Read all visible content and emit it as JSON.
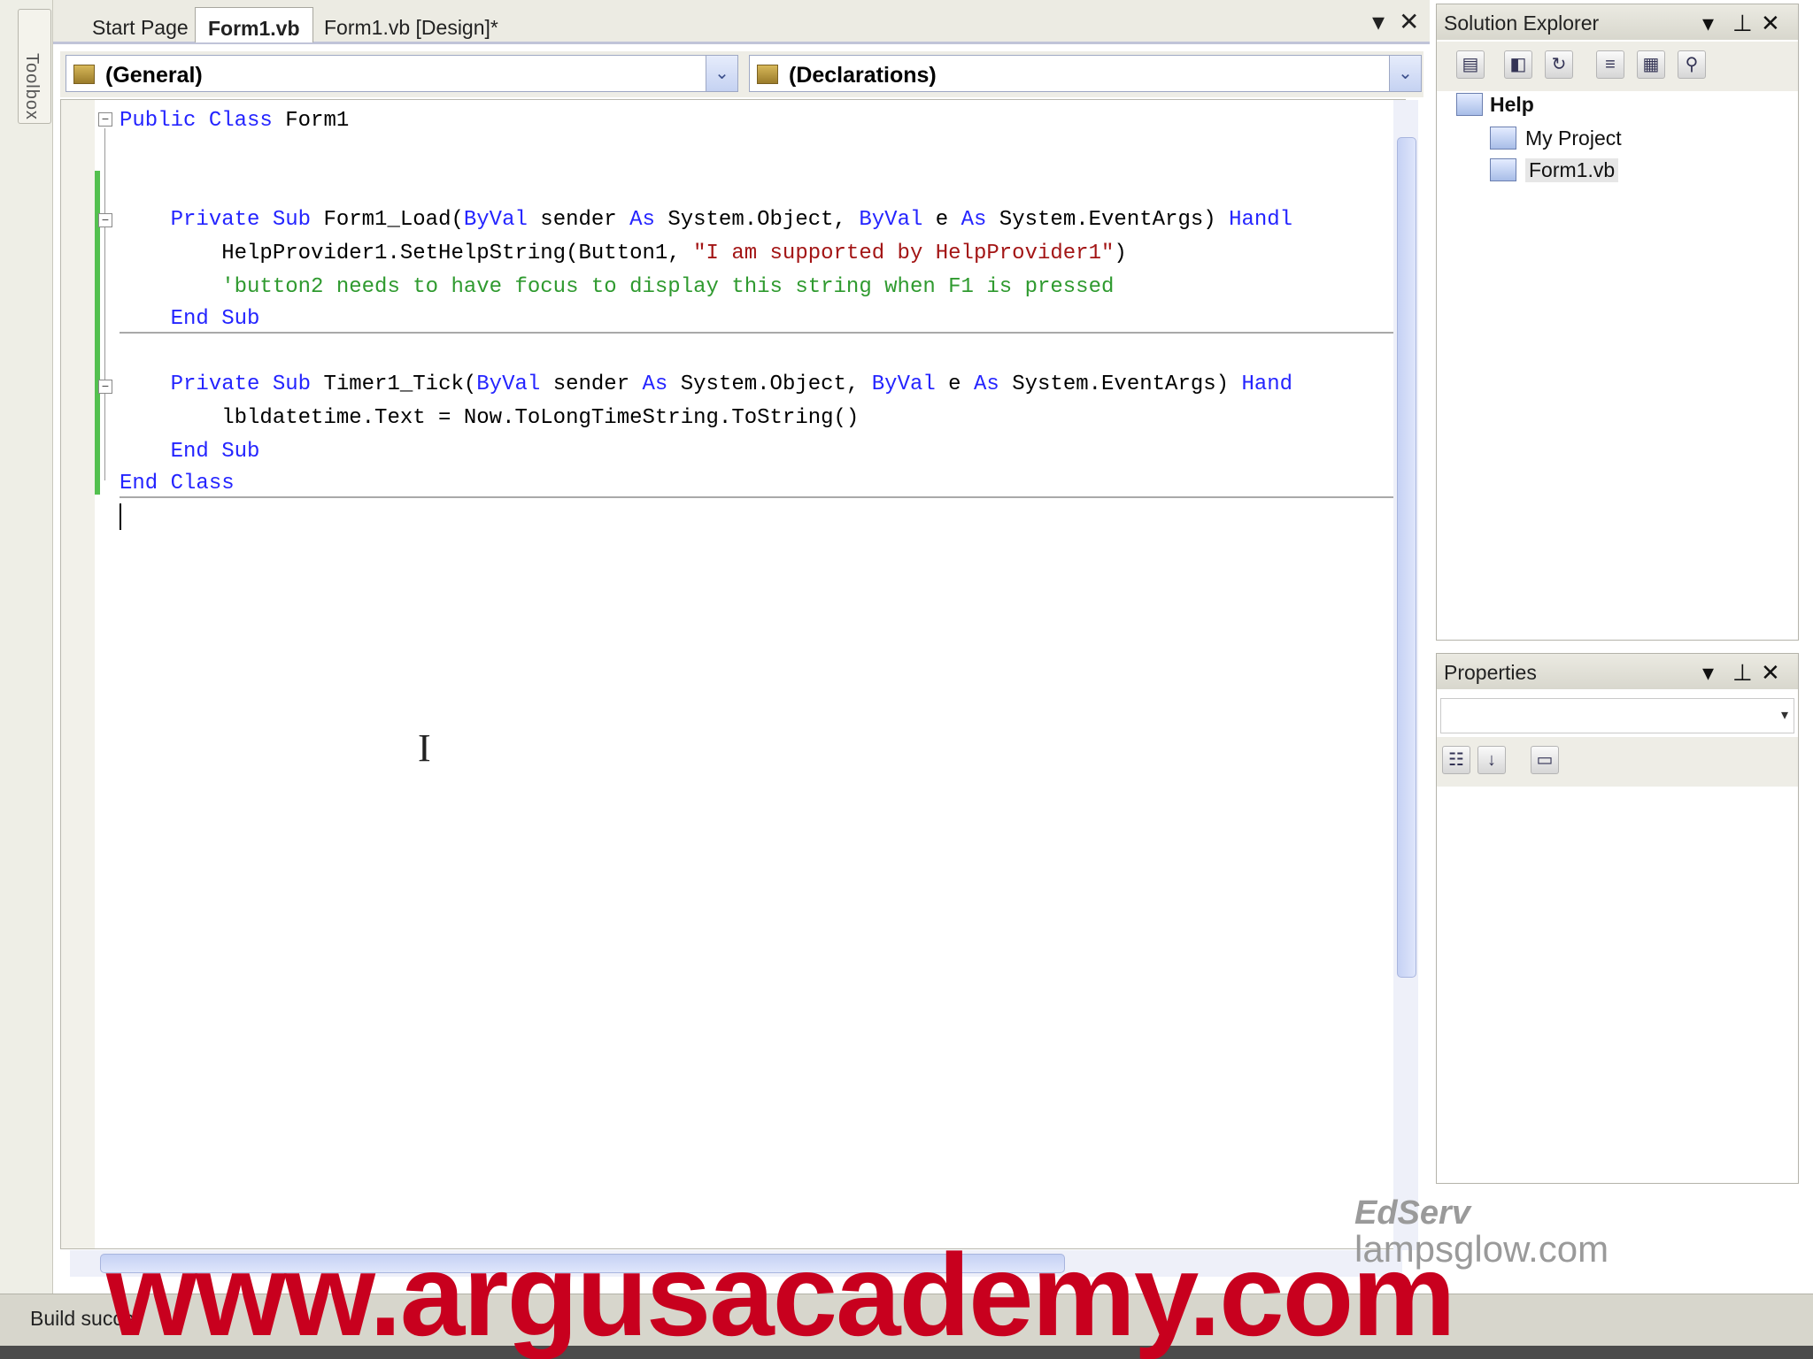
{
  "toolbox": {
    "label": "Toolbox"
  },
  "tabs": [
    {
      "label": "Start Page"
    },
    {
      "label": "Form1.vb"
    },
    {
      "label": "Form1.vb [Design]*"
    }
  ],
  "tab_controls": {
    "menu": "▾",
    "close": "✕"
  },
  "nav": {
    "left_combo": "(General)",
    "right_combo": "(Declarations)",
    "drop_glyph": "⌄"
  },
  "code_lines": [
    {
      "kw1": "Public Class",
      "text": " Form1"
    },
    {
      "indent": "    ",
      "kw1": "Private Sub",
      "text1": " Form1_Load(",
      "kw2": "ByVal",
      "text2": " sender ",
      "kw3": "As",
      "text3": " System.Object, ",
      "kw4": "ByVal",
      "text4": " e ",
      "kw5": "As",
      "text5": " System.EventArgs) ",
      "kw6": "Handl"
    },
    {
      "indent": "        ",
      "text1": "HelpProvider1.SetHelpString(Button1, ",
      "str": "\"I am supported by HelpProvider1\"",
      "text2": ")"
    },
    {
      "indent": "        ",
      "cmt": "'button2 needs to have focus to display this string when F1 is pressed"
    },
    {
      "indent": "    ",
      "kw1": "End Sub"
    },
    {
      "indent": "    ",
      "kw1": "Private Sub",
      "text1": " Timer1_Tick(",
      "kw2": "ByVal",
      "text2": " sender ",
      "kw3": "As",
      "text3": " System.Object, ",
      "kw4": "ByVal",
      "text4": " e ",
      "kw5": "As",
      "text5": " System.EventArgs) ",
      "kw6": "Hand"
    },
    {
      "indent": "        ",
      "text1": "lbldatetime.Text = Now.ToLongTimeString.ToString()"
    },
    {
      "indent": "    ",
      "kw1": "End Sub"
    },
    {
      "kw1": "End Class"
    }
  ],
  "solution_explorer": {
    "title": "Solution Explorer",
    "project": "Help",
    "items": [
      "My Project",
      "Form1.vb"
    ]
  },
  "properties": {
    "title": "Properties"
  },
  "panel_controls": {
    "menu": "▾",
    "pin": "⊥",
    "close": "✕"
  },
  "status": {
    "text": "Build succe"
  },
  "overlays": {
    "watermark": "www.argusacademy.com",
    "edserv": "EdServ",
    "lampsglow": "lampsglow.com"
  },
  "cursor": {
    "glyph": "I"
  }
}
